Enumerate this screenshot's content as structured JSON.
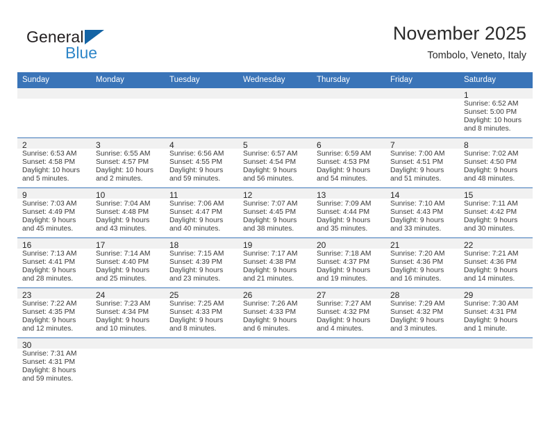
{
  "brand": {
    "name_part1": "General",
    "name_part2": "Blue",
    "triangle_color": "#1464a5",
    "blue_color": "#2e86c8"
  },
  "header": {
    "title": "November 2025",
    "subtitle": "Tombolo, Veneto, Italy"
  },
  "theme": {
    "header_blue": "#3a74b8",
    "daynum_gray": "#f1f1f1",
    "text": "#3a3a3a"
  },
  "calendar": {
    "weekday_headers": [
      "Sunday",
      "Monday",
      "Tuesday",
      "Wednesday",
      "Thursday",
      "Friday",
      "Saturday"
    ],
    "weeks": [
      [
        {
          "day": "",
          "sunrise": "",
          "sunset": "",
          "daylight": ""
        },
        {
          "day": "",
          "sunrise": "",
          "sunset": "",
          "daylight": ""
        },
        {
          "day": "",
          "sunrise": "",
          "sunset": "",
          "daylight": ""
        },
        {
          "day": "",
          "sunrise": "",
          "sunset": "",
          "daylight": ""
        },
        {
          "day": "",
          "sunrise": "",
          "sunset": "",
          "daylight": ""
        },
        {
          "day": "",
          "sunrise": "",
          "sunset": "",
          "daylight": ""
        },
        {
          "day": "1",
          "sunrise": "Sunrise: 6:52 AM",
          "sunset": "Sunset: 5:00 PM",
          "daylight": "Daylight: 10 hours and 8 minutes."
        }
      ],
      [
        {
          "day": "2",
          "sunrise": "Sunrise: 6:53 AM",
          "sunset": "Sunset: 4:58 PM",
          "daylight": "Daylight: 10 hours and 5 minutes."
        },
        {
          "day": "3",
          "sunrise": "Sunrise: 6:55 AM",
          "sunset": "Sunset: 4:57 PM",
          "daylight": "Daylight: 10 hours and 2 minutes."
        },
        {
          "day": "4",
          "sunrise": "Sunrise: 6:56 AM",
          "sunset": "Sunset: 4:55 PM",
          "daylight": "Daylight: 9 hours and 59 minutes."
        },
        {
          "day": "5",
          "sunrise": "Sunrise: 6:57 AM",
          "sunset": "Sunset: 4:54 PM",
          "daylight": "Daylight: 9 hours and 56 minutes."
        },
        {
          "day": "6",
          "sunrise": "Sunrise: 6:59 AM",
          "sunset": "Sunset: 4:53 PM",
          "daylight": "Daylight: 9 hours and 54 minutes."
        },
        {
          "day": "7",
          "sunrise": "Sunrise: 7:00 AM",
          "sunset": "Sunset: 4:51 PM",
          "daylight": "Daylight: 9 hours and 51 minutes."
        },
        {
          "day": "8",
          "sunrise": "Sunrise: 7:02 AM",
          "sunset": "Sunset: 4:50 PM",
          "daylight": "Daylight: 9 hours and 48 minutes."
        }
      ],
      [
        {
          "day": "9",
          "sunrise": "Sunrise: 7:03 AM",
          "sunset": "Sunset: 4:49 PM",
          "daylight": "Daylight: 9 hours and 45 minutes."
        },
        {
          "day": "10",
          "sunrise": "Sunrise: 7:04 AM",
          "sunset": "Sunset: 4:48 PM",
          "daylight": "Daylight: 9 hours and 43 minutes."
        },
        {
          "day": "11",
          "sunrise": "Sunrise: 7:06 AM",
          "sunset": "Sunset: 4:47 PM",
          "daylight": "Daylight: 9 hours and 40 minutes."
        },
        {
          "day": "12",
          "sunrise": "Sunrise: 7:07 AM",
          "sunset": "Sunset: 4:45 PM",
          "daylight": "Daylight: 9 hours and 38 minutes."
        },
        {
          "day": "13",
          "sunrise": "Sunrise: 7:09 AM",
          "sunset": "Sunset: 4:44 PM",
          "daylight": "Daylight: 9 hours and 35 minutes."
        },
        {
          "day": "14",
          "sunrise": "Sunrise: 7:10 AM",
          "sunset": "Sunset: 4:43 PM",
          "daylight": "Daylight: 9 hours and 33 minutes."
        },
        {
          "day": "15",
          "sunrise": "Sunrise: 7:11 AM",
          "sunset": "Sunset: 4:42 PM",
          "daylight": "Daylight: 9 hours and 30 minutes."
        }
      ],
      [
        {
          "day": "16",
          "sunrise": "Sunrise: 7:13 AM",
          "sunset": "Sunset: 4:41 PM",
          "daylight": "Daylight: 9 hours and 28 minutes."
        },
        {
          "day": "17",
          "sunrise": "Sunrise: 7:14 AM",
          "sunset": "Sunset: 4:40 PM",
          "daylight": "Daylight: 9 hours and 25 minutes."
        },
        {
          "day": "18",
          "sunrise": "Sunrise: 7:15 AM",
          "sunset": "Sunset: 4:39 PM",
          "daylight": "Daylight: 9 hours and 23 minutes."
        },
        {
          "day": "19",
          "sunrise": "Sunrise: 7:17 AM",
          "sunset": "Sunset: 4:38 PM",
          "daylight": "Daylight: 9 hours and 21 minutes."
        },
        {
          "day": "20",
          "sunrise": "Sunrise: 7:18 AM",
          "sunset": "Sunset: 4:37 PM",
          "daylight": "Daylight: 9 hours and 19 minutes."
        },
        {
          "day": "21",
          "sunrise": "Sunrise: 7:20 AM",
          "sunset": "Sunset: 4:36 PM",
          "daylight": "Daylight: 9 hours and 16 minutes."
        },
        {
          "day": "22",
          "sunrise": "Sunrise: 7:21 AM",
          "sunset": "Sunset: 4:36 PM",
          "daylight": "Daylight: 9 hours and 14 minutes."
        }
      ],
      [
        {
          "day": "23",
          "sunrise": "Sunrise: 7:22 AM",
          "sunset": "Sunset: 4:35 PM",
          "daylight": "Daylight: 9 hours and 12 minutes."
        },
        {
          "day": "24",
          "sunrise": "Sunrise: 7:23 AM",
          "sunset": "Sunset: 4:34 PM",
          "daylight": "Daylight: 9 hours and 10 minutes."
        },
        {
          "day": "25",
          "sunrise": "Sunrise: 7:25 AM",
          "sunset": "Sunset: 4:33 PM",
          "daylight": "Daylight: 9 hours and 8 minutes."
        },
        {
          "day": "26",
          "sunrise": "Sunrise: 7:26 AM",
          "sunset": "Sunset: 4:33 PM",
          "daylight": "Daylight: 9 hours and 6 minutes."
        },
        {
          "day": "27",
          "sunrise": "Sunrise: 7:27 AM",
          "sunset": "Sunset: 4:32 PM",
          "daylight": "Daylight: 9 hours and 4 minutes."
        },
        {
          "day": "28",
          "sunrise": "Sunrise: 7:29 AM",
          "sunset": "Sunset: 4:32 PM",
          "daylight": "Daylight: 9 hours and 3 minutes."
        },
        {
          "day": "29",
          "sunrise": "Sunrise: 7:30 AM",
          "sunset": "Sunset: 4:31 PM",
          "daylight": "Daylight: 9 hours and 1 minute."
        }
      ],
      [
        {
          "day": "30",
          "sunrise": "Sunrise: 7:31 AM",
          "sunset": "Sunset: 4:31 PM",
          "daylight": "Daylight: 8 hours and 59 minutes."
        },
        {
          "day": "",
          "sunrise": "",
          "sunset": "",
          "daylight": ""
        },
        {
          "day": "",
          "sunrise": "",
          "sunset": "",
          "daylight": ""
        },
        {
          "day": "",
          "sunrise": "",
          "sunset": "",
          "daylight": ""
        },
        {
          "day": "",
          "sunrise": "",
          "sunset": "",
          "daylight": ""
        },
        {
          "day": "",
          "sunrise": "",
          "sunset": "",
          "daylight": ""
        },
        {
          "day": "",
          "sunrise": "",
          "sunset": "",
          "daylight": ""
        }
      ]
    ]
  }
}
